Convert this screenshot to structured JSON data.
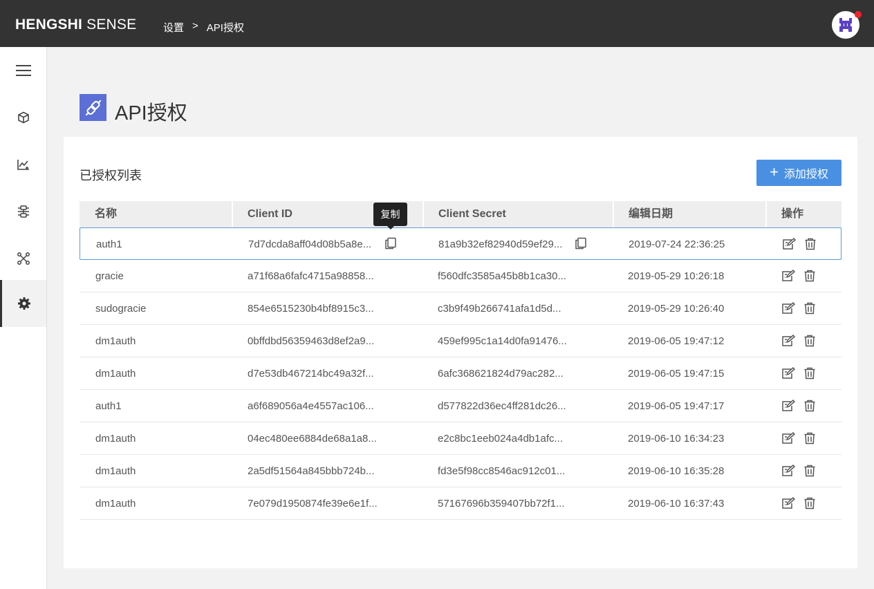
{
  "header": {
    "logo_bold": "HENGSHI",
    "logo_light": "SENSE",
    "breadcrumb": [
      "设置",
      ">",
      "API授权"
    ]
  },
  "sidebar": {
    "items": [
      {
        "icon": "menu-icon"
      },
      {
        "icon": "cube-icon"
      },
      {
        "icon": "chart-icon"
      },
      {
        "icon": "data-icon"
      },
      {
        "icon": "network-icon"
      },
      {
        "icon": "gear-icon",
        "active": true
      }
    ]
  },
  "page": {
    "title": "API授权",
    "list_title": "已授权列表",
    "add_button": "添加授权",
    "tooltip": "复制"
  },
  "table": {
    "columns": [
      "名称",
      "Client ID",
      "Client Secret",
      "编辑日期",
      "操作"
    ],
    "rows": [
      {
        "name": "auth1",
        "client_id": "7d7dcda8aff04d08b5a8e...",
        "client_secret": "81a9b32ef82940d59ef29...",
        "date": "2019-07-24 22:36:25"
      },
      {
        "name": "gracie",
        "client_id": "a71f68a6fafc4715a98858...",
        "client_secret": "f560dfc3585a45b8b1ca30...",
        "date": "2019-05-29 10:26:18"
      },
      {
        "name": "sudogracie",
        "client_id": "854e6515230b4bf8915c3...",
        "client_secret": "c3b9f49b266741afa1d5d...",
        "date": "2019-05-29 10:26:40"
      },
      {
        "name": "dm1auth",
        "client_id": "0bffdbd56359463d8ef2a9...",
        "client_secret": "459ef995c1a14d0fa91476...",
        "date": "2019-06-05 19:47:12"
      },
      {
        "name": "dm1auth",
        "client_id": "d7e53db467214bc49a32f...",
        "client_secret": "6afc368621824d79ac282...",
        "date": "2019-06-05 19:47:15"
      },
      {
        "name": "auth1",
        "client_id": "a6f689056a4e4557ac106...",
        "client_secret": "d577822d36ec4ff281dc26...",
        "date": "2019-06-05 19:47:17"
      },
      {
        "name": "dm1auth",
        "client_id": "04ec480ee6884de68a1a8...",
        "client_secret": "e2c8bc1eeb024a4db1afc...",
        "date": "2019-06-10 16:34:23"
      },
      {
        "name": "dm1auth",
        "client_id": "2a5df51564a845bbb724b...",
        "client_secret": "fd3e5f98cc8546ac912c01...",
        "date": "2019-06-10 16:35:28"
      },
      {
        "name": "dm1auth",
        "client_id": "7e079d1950874fe39e6e1f...",
        "client_secret": "57167696b359407bb72f1...",
        "date": "2019-06-10 16:37:43"
      }
    ]
  },
  "colors": {
    "topbar": "#333333",
    "accent": "#4a90e2",
    "title_icon_bg": "#5b6fd6",
    "notification_dot": "#f5222d"
  }
}
